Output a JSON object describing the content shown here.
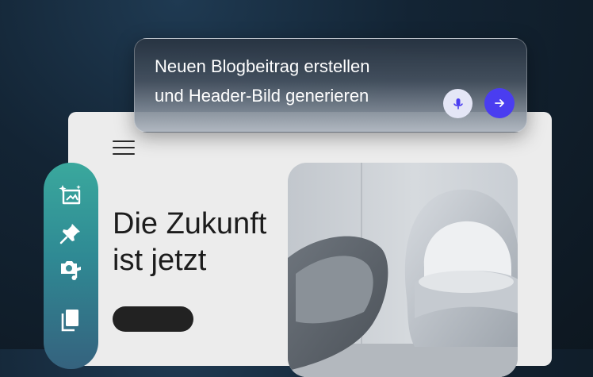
{
  "prompt": {
    "text": "Neuen Blogbeitrag erstellen\nund Header-Bild generieren",
    "icons": {
      "mic": "microphone-icon",
      "send": "arrow-right-icon"
    }
  },
  "website": {
    "headline": "Die Zukunft\nist jetzt",
    "hero_image": "armchair-photo"
  },
  "toolbar": {
    "icons": [
      "ai-image-icon",
      "pin-icon",
      "media-icon",
      "copy-icon"
    ]
  },
  "colors": {
    "send_button": "#4a3df0",
    "mic_button": "#e4e6f6",
    "toolbar_top": "#3aa89d",
    "toolbar_bottom": "#35627e",
    "page_bg": "#ececec"
  }
}
